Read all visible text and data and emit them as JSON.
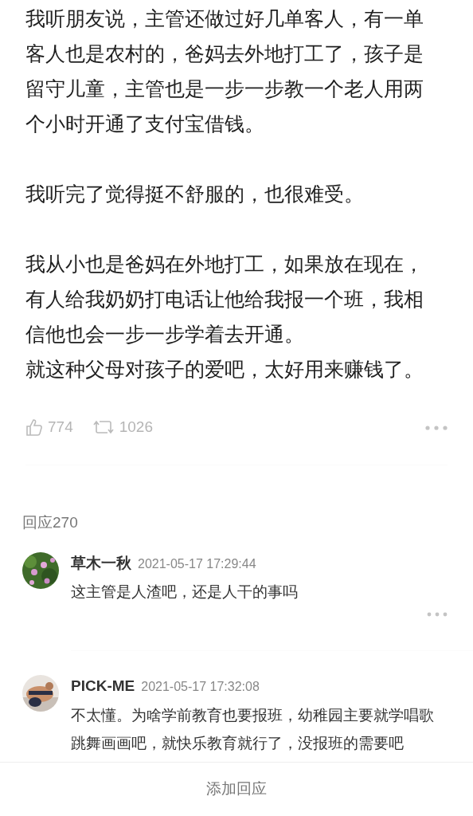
{
  "post": {
    "paragraphs": [
      [
        "我听朋友说，主管还做过好几单客人，有一单客人也是农村的，爸妈去外地打工了，孩子是留守儿童，主管也是一步一步教一个老人用两个小时开通了支付宝借钱。"
      ],
      [
        "我听完了觉得挺不舒服的，也很难受。"
      ],
      [
        "我从小也是爸妈在外地打工，如果放在现在，有人给我奶奶打电话让他给我报一个班，我相信他也会一步一步学着去开通。",
        "就这种父母对孩子的爱吧，太好用来赚钱了。"
      ]
    ],
    "likes": "774",
    "reshares": "1026"
  },
  "replies_header": "回应270",
  "comments": [
    {
      "author": "草木一秋",
      "time": "2021-05-17 17:29:44",
      "text": "这主管是人渣吧，还是人干的事吗"
    },
    {
      "author": "PICK-ME",
      "time": "2021-05-17 17:32:08",
      "text": "不太懂。为啥学前教育也要报班，幼稚园主要就学唱歌跳舞画画吧，就快乐教育就行了，没报班的需要吧"
    }
  ],
  "bottom_bar": {
    "label": "添加回应"
  }
}
